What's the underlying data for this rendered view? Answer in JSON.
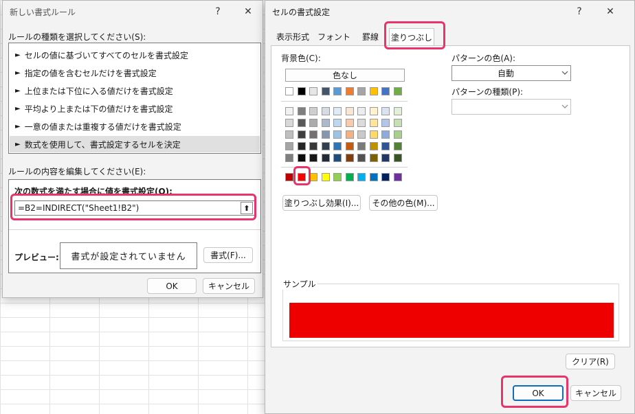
{
  "left_dialog": {
    "title": "新しい書式ルール",
    "help": "?",
    "close": "✕",
    "rule_type_label": "ルールの種類を選択してください(S):",
    "rule_types": [
      "セルの値に基づいてすべてのセルを書式設定",
      "指定の値を含むセルだけを書式設定",
      "上位または下位に入る値だけを書式設定",
      "平均より上または下の値だけを書式設定",
      "一意の値または重複する値だけを書式設定",
      "数式を使用して、書式設定するセルを決定"
    ],
    "rule_arrow": "►",
    "edit_label": "ルールの内容を編集してください(E):",
    "formula_heading": "次の数式を満たす場合に値を書式設定(O):",
    "formula_value": "=B2=INDIRECT(\"Sheet1!B2\")",
    "collapse_icon": "⬆",
    "preview_label": "プレビュー:",
    "preview_text": "書式が設定されていません",
    "format_button": "書式(F)...",
    "ok": "OK",
    "cancel": "キャンセル"
  },
  "right_dialog": {
    "title": "セルの書式設定",
    "help": "?",
    "close": "✕",
    "tabs": [
      "表示形式",
      "フォント",
      "罫線",
      "塗りつぶし"
    ],
    "active_tab": "塗りつぶし",
    "bg_color_label": "背景色(C):",
    "no_color_button": "色なし",
    "theme_top_row": [
      "#ffffff",
      "#000000",
      "#e7e6e6",
      "#44546a",
      "#5b9bd5",
      "#ed7d31",
      "#a5a5a5",
      "#ffc000",
      "#4472c4",
      "#70ad47"
    ],
    "theme_shades": [
      [
        "#f2f2f2",
        "#7f7f7f",
        "#d0cece",
        "#d6dce4",
        "#deebf6",
        "#fbe5d5",
        "#ededed",
        "#fff2cc",
        "#d9e2f3",
        "#e2efd9"
      ],
      [
        "#d8d8d8",
        "#595959",
        "#aeabab",
        "#adb9ca",
        "#bdd7ee",
        "#f7cbac",
        "#dbdbdb",
        "#fee599",
        "#b4c6e7",
        "#c5e0b3"
      ],
      [
        "#bfbfbf",
        "#3f3f3f",
        "#757070",
        "#8496b0",
        "#9dc3e6",
        "#f4b183",
        "#c9c9c9",
        "#ffd966",
        "#8eaadb",
        "#a8d08d"
      ],
      [
        "#a5a5a5",
        "#262626",
        "#3a3838",
        "#323f4f",
        "#2e75b5",
        "#c55a11",
        "#7b7b7b",
        "#bf9000",
        "#2f5496",
        "#538135"
      ],
      [
        "#7f7f7f",
        "#0c0c0c",
        "#171616",
        "#222a35",
        "#1e4e79",
        "#833c0b",
        "#525252",
        "#7f6000",
        "#1f3864",
        "#375623"
      ]
    ],
    "standard_colors": [
      "#c00000",
      "#ff0000",
      "#ffc000",
      "#ffff00",
      "#92d050",
      "#00b050",
      "#00b0f0",
      "#0070c0",
      "#002060",
      "#7030a0"
    ],
    "fill_effects_button": "塗りつぶし効果(I)...",
    "more_colors_button": "その他の色(M)...",
    "pattern_color_label": "パターンの色(A):",
    "pattern_color_value": "自動",
    "pattern_style_label": "パターンの種類(P):",
    "pattern_style_value": "",
    "sample_label": "サンプル",
    "sample_color": "#ee0000",
    "clear_button": "クリア(R)",
    "ok": "OK",
    "cancel": "キャンセル"
  },
  "colors": {
    "highlight": "#e8336b",
    "selected_rule_bg": "#e0e0e0"
  }
}
